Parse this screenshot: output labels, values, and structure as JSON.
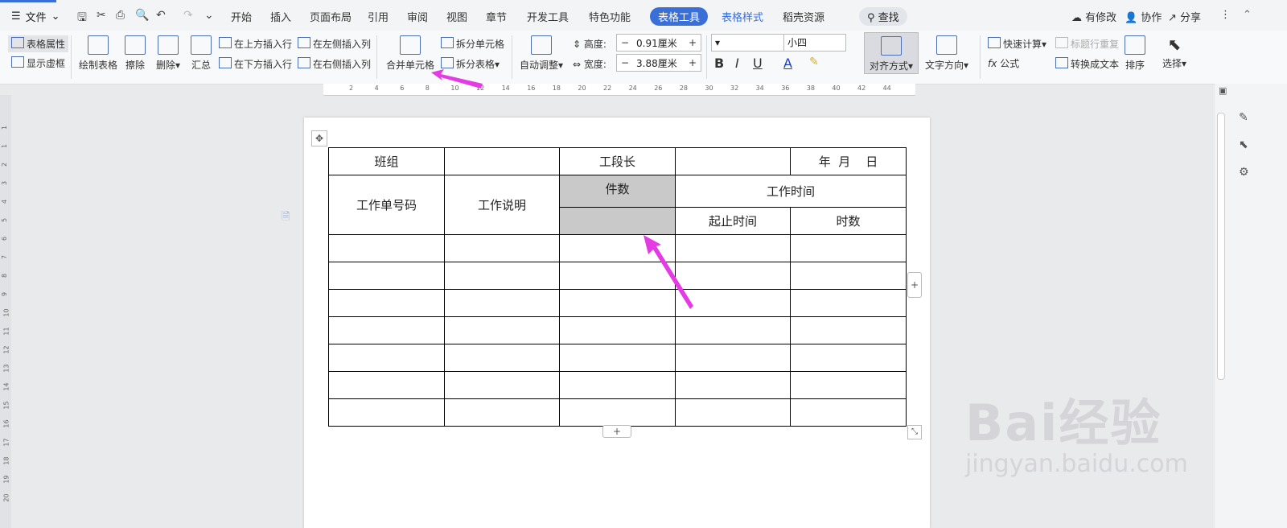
{
  "topbar": {
    "file_label": "文件",
    "menu_tabs": [
      "开始",
      "插入",
      "页面布局",
      "引用",
      "审阅",
      "视图",
      "章节",
      "开发工具",
      "特色功能",
      "表格工具",
      "表格样式",
      "稻壳资源"
    ],
    "active_tab": "表格工具",
    "search_label": "查找",
    "right_buttons": [
      "有修改",
      "协作",
      "分享"
    ]
  },
  "ribbon": {
    "table_props": "表格属性",
    "show_gridlines": "显示虚框",
    "draw_table": "绘制表格",
    "erase": "擦除",
    "delete": "删除",
    "summary": "汇总",
    "insert_above": "在上方插入行",
    "insert_below": "在下方插入行",
    "insert_left": "在左侧插入列",
    "insert_right": "在右侧插入列",
    "merge_cells": "合并单元格",
    "split_cells": "拆分单元格",
    "split_table": "拆分表格",
    "auto_adjust": "自动调整",
    "height_label": "高度:",
    "height_value": "0.91厘米",
    "width_label": "宽度:",
    "width_value": "3.88厘米",
    "font_size": "小四",
    "align": "对齐方式",
    "text_direction": "文字方向",
    "quick_calc": "快速计算",
    "repeat_header": "标题行重复",
    "formula": "公式",
    "to_text": "转换成文本",
    "sort": "排序",
    "select": "选择"
  },
  "table": {
    "team": "班组",
    "section_leader": "工段长",
    "date": "年  月    日",
    "work_order": "工作单号码",
    "work_desc": "工作说明",
    "pieces": "件数",
    "work_time": "工作时间",
    "start_end": "起止时间",
    "hours": "时数"
  },
  "ruler_numbers": [
    "2",
    "4",
    "6",
    "8",
    "10",
    "12",
    "14",
    "16",
    "18",
    "20",
    "22",
    "24",
    "26",
    "28",
    "30",
    "32",
    "34",
    "36",
    "38",
    "40",
    "42",
    "44"
  ],
  "vruler_numbers": [
    "1",
    "1",
    "2",
    "3",
    "4",
    "5",
    "6",
    "7",
    "8",
    "9",
    "10",
    "11",
    "12",
    "13",
    "14",
    "15",
    "16",
    "17",
    "18",
    "19",
    "20"
  ],
  "watermark": {
    "brand": "Bai经验",
    "url": "jingyan.baidu.com"
  },
  "colors": {
    "accent": "#3b6fd8",
    "arrow": "#e43be4",
    "selected_cell": "#c9c9c9"
  }
}
